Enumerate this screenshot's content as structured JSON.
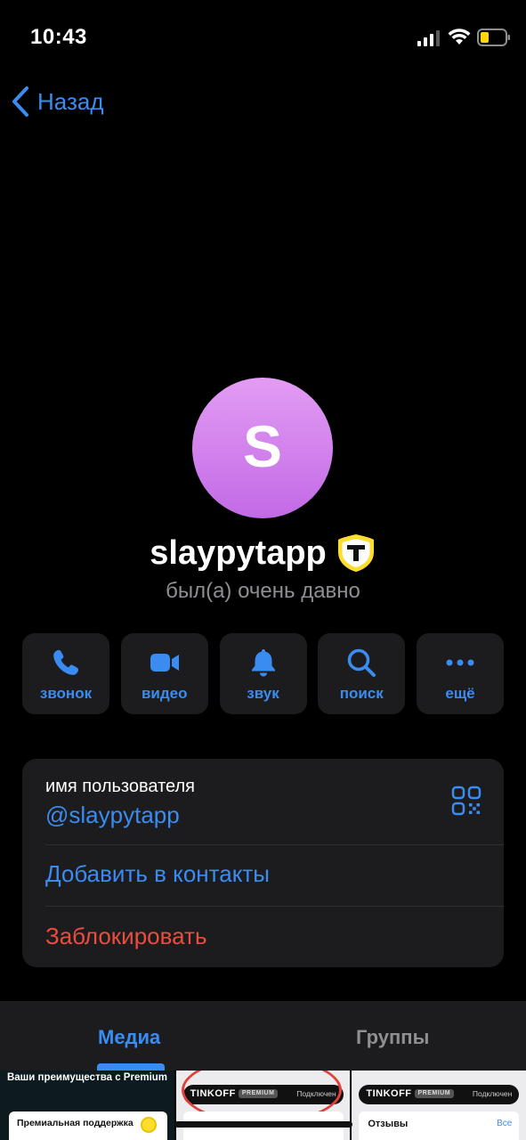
{
  "status_bar": {
    "time": "10:43"
  },
  "nav": {
    "back_label": "Назад"
  },
  "profile": {
    "avatar_letter": "S",
    "avatar_colors": [
      "#e39cf3",
      "#c26ae6"
    ],
    "name": "slaypytapp",
    "last_seen": "был(а) очень давно",
    "badge_letter": "Т"
  },
  "actions": [
    {
      "label": "звонок",
      "icon": "phone-icon"
    },
    {
      "label": "видео",
      "icon": "video-icon"
    },
    {
      "label": "звук",
      "icon": "bell-icon"
    },
    {
      "label": "поиск",
      "icon": "search-icon"
    },
    {
      "label": "ещё",
      "icon": "more-icon"
    }
  ],
  "info": {
    "username_caption": "имя пользователя",
    "username": "@slaypytapp",
    "add_contact": "Добавить в контакты",
    "block": "Заблокировать"
  },
  "tabs": {
    "media": "Медиа",
    "groups": "Группы"
  },
  "media": {
    "thumb1_title": "Ваши преимущества с Premium",
    "thumb1_card": "Премиальная поддержка",
    "tinkoff_name": "TINKOFF",
    "tinkoff_premium": "PREMIUM",
    "tinkoff_connected": "Подключен",
    "reviews": "Отзывы",
    "all": "Все"
  },
  "colors": {
    "accent": "#3a8cf0",
    "destructive": "#eb4d3d",
    "card_bg": "#1c1c1e",
    "secondary_text": "#8e8e93"
  }
}
